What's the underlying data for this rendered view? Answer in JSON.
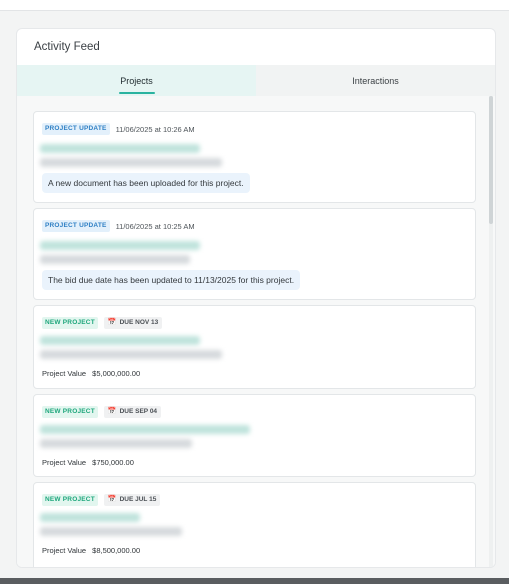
{
  "panel": {
    "title": "Activity Feed"
  },
  "tabs": [
    {
      "label": "Projects",
      "active": true
    },
    {
      "label": "Interactions",
      "active": false
    }
  ],
  "feed": {
    "items": [
      {
        "badge": "PROJECT UPDATE",
        "timestamp": "11/06/2025 at 10:26 AM",
        "message": "A new document has been uploaded for this project."
      },
      {
        "badge": "PROJECT UPDATE",
        "timestamp": "11/06/2025 at 10:25 AM",
        "message": "The bid due date has been updated to 11/13/2025 for this project."
      },
      {
        "badge": "NEW PROJECT",
        "due": "DUE NOV 13",
        "value_label": "Project Value",
        "value": "$5,000,000.00"
      },
      {
        "badge": "NEW PROJECT",
        "due": "DUE SEP 04",
        "value_label": "Project Value",
        "value": "$750,000.00"
      },
      {
        "badge": "NEW PROJECT",
        "due": "DUE JUL 15",
        "value_label": "Project Value",
        "value": "$8,500,000.00"
      }
    ]
  },
  "icons": {
    "calendar": "calendar-icon"
  },
  "colors": {
    "accent": "#2ab3a0",
    "update_badge": "#2e7fc4",
    "new_badge": "#1ea77c"
  }
}
